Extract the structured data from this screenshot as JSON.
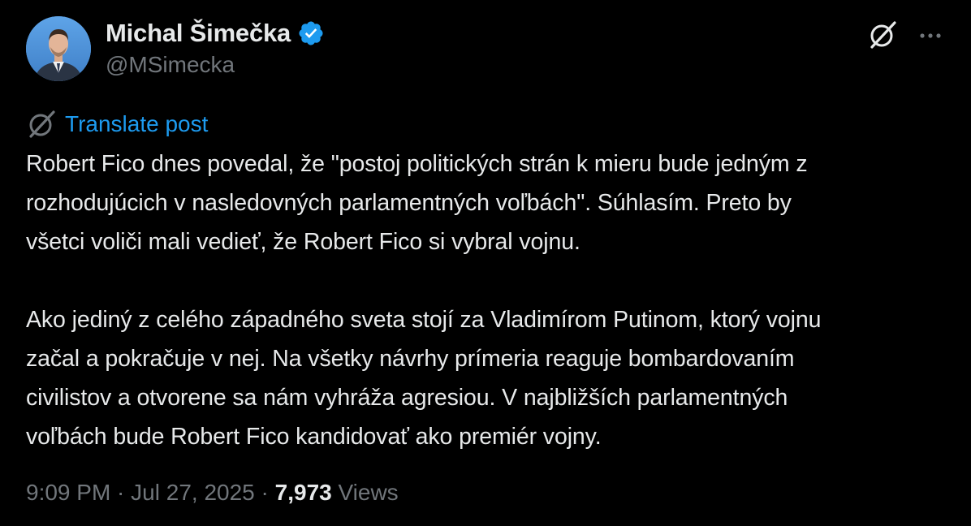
{
  "author": {
    "display_name": "Michal Šimečka",
    "handle": "@MSimecka",
    "verified": true
  },
  "colors": {
    "background": "#000000",
    "text": "#e7e9ea",
    "muted": "#71767b",
    "link": "#1d9bf0",
    "verified": "#1d9bf0"
  },
  "icons": {
    "verified": "verified-badge-icon",
    "grok": "grok-icon",
    "more": "more-icon",
    "translate": "grok-translate-icon"
  },
  "translate": {
    "label": "Translate post"
  },
  "post": {
    "paragraphs": [
      "Robert Fico dnes povedal, že \"postoj politických strán k mieru bude jedným z\nrozhodujúcich v nasledovných parlamentných voľbách\". Súhlasím. Preto by\nvšetci voliči mali vedieť, že Robert Fico si vybral vojnu.",
      "Ako jediný z celého západného sveta stojí za Vladimírom Putinom, ktorý vojnu\nzačal a pokračuje v nej. Na všetky návrhy prímeria reaguje bombardovaním\ncivilistov a otvorene sa nám vyhráža agresiou. V najbližších parlamentných\nvoľbách bude Robert Fico kandidovať ako premiér vojny."
    ]
  },
  "meta": {
    "time": "9:09 PM",
    "separator": " · ",
    "date": "Jul 27, 2025",
    "views_count": "7,973",
    "views_label": "Views"
  }
}
